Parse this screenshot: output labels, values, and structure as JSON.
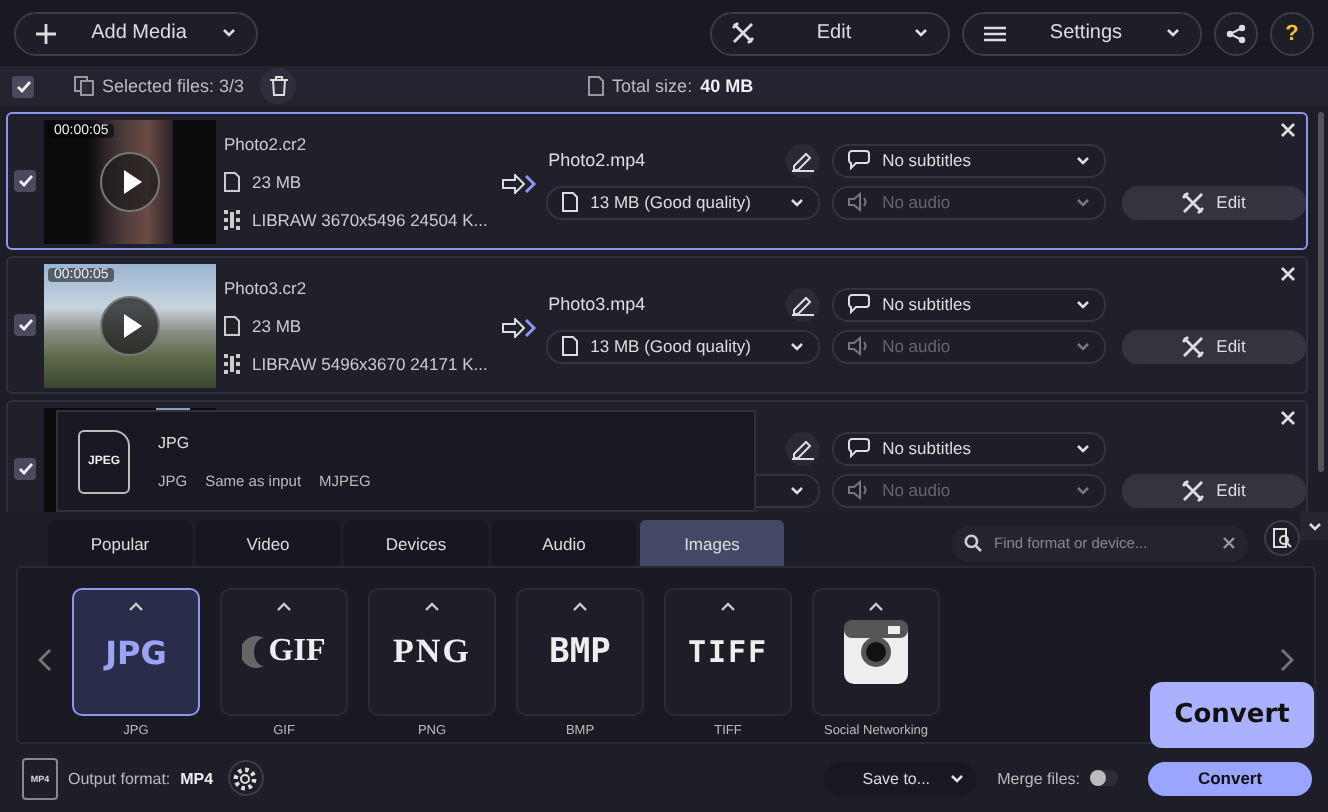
{
  "toolbar": {
    "add_media": "Add Media",
    "edit": "Edit",
    "settings": "Settings",
    "help": "?"
  },
  "selection_bar": {
    "checked": true,
    "selected_files": "Selected files: 3/3",
    "total_size_label": "Total size:",
    "total_size": "40 MB"
  },
  "files": [
    {
      "checked": true,
      "selected": true,
      "duration": "00:00:05",
      "source_name": "Photo2.cr2",
      "source_size": "23 MB",
      "codec_info": "LIBRAW 3670x5496 24504 K...",
      "output_name": "Photo2.mp4",
      "output_quality": "13 MB (Good quality)",
      "subtitles": "No subtitles",
      "audio": "No audio",
      "edit": "Edit"
    },
    {
      "checked": true,
      "selected": false,
      "duration": "00:00:05",
      "source_name": "Photo3.cr2",
      "source_size": "23 MB",
      "codec_info": "LIBRAW 5496x3670 24171 K...",
      "output_name": "Photo3.mp4",
      "output_quality": "13 MB (Good quality)",
      "subtitles": "No subtitles",
      "audio": "No audio",
      "edit": "Edit"
    },
    {
      "checked": true,
      "selected": false,
      "subtitles": "No subtitles",
      "audio": "No audio",
      "edit": "Edit"
    }
  ],
  "format_popup": {
    "title": "JPG",
    "details": [
      "JPG",
      "Same as input",
      "MJPEG"
    ],
    "icon_label": "JPEG"
  },
  "tabs": [
    {
      "label": "Popular",
      "selected": false
    },
    {
      "label": "Video",
      "selected": false
    },
    {
      "label": "Devices",
      "selected": false
    },
    {
      "label": "Audio",
      "selected": false
    },
    {
      "label": "Images",
      "selected": true
    }
  ],
  "search": {
    "placeholder": "Find format or device..."
  },
  "formats": [
    {
      "kind": "jpg",
      "logo": "JPG",
      "label": "JPG",
      "selected": true
    },
    {
      "kind": "gif",
      "logo": "GIF",
      "label": "GIF",
      "selected": false
    },
    {
      "kind": "png",
      "logo": "PNG",
      "label": "PNG",
      "selected": false
    },
    {
      "kind": "bmp",
      "logo": "BMP",
      "label": "BMP",
      "selected": false
    },
    {
      "kind": "tiff",
      "logo": "TIFF",
      "label": "TIFF",
      "selected": false
    },
    {
      "kind": "social",
      "label": "Social Networking",
      "selected": false
    }
  ],
  "bottom_bar": {
    "format_icon_label": "MP4",
    "output_format_label": "Output format:",
    "output_format": "MP4",
    "save_to": "Save to...",
    "merge_label": "Merge files:",
    "merge_on": false,
    "convert": "Convert",
    "tooltip": "Convert"
  }
}
